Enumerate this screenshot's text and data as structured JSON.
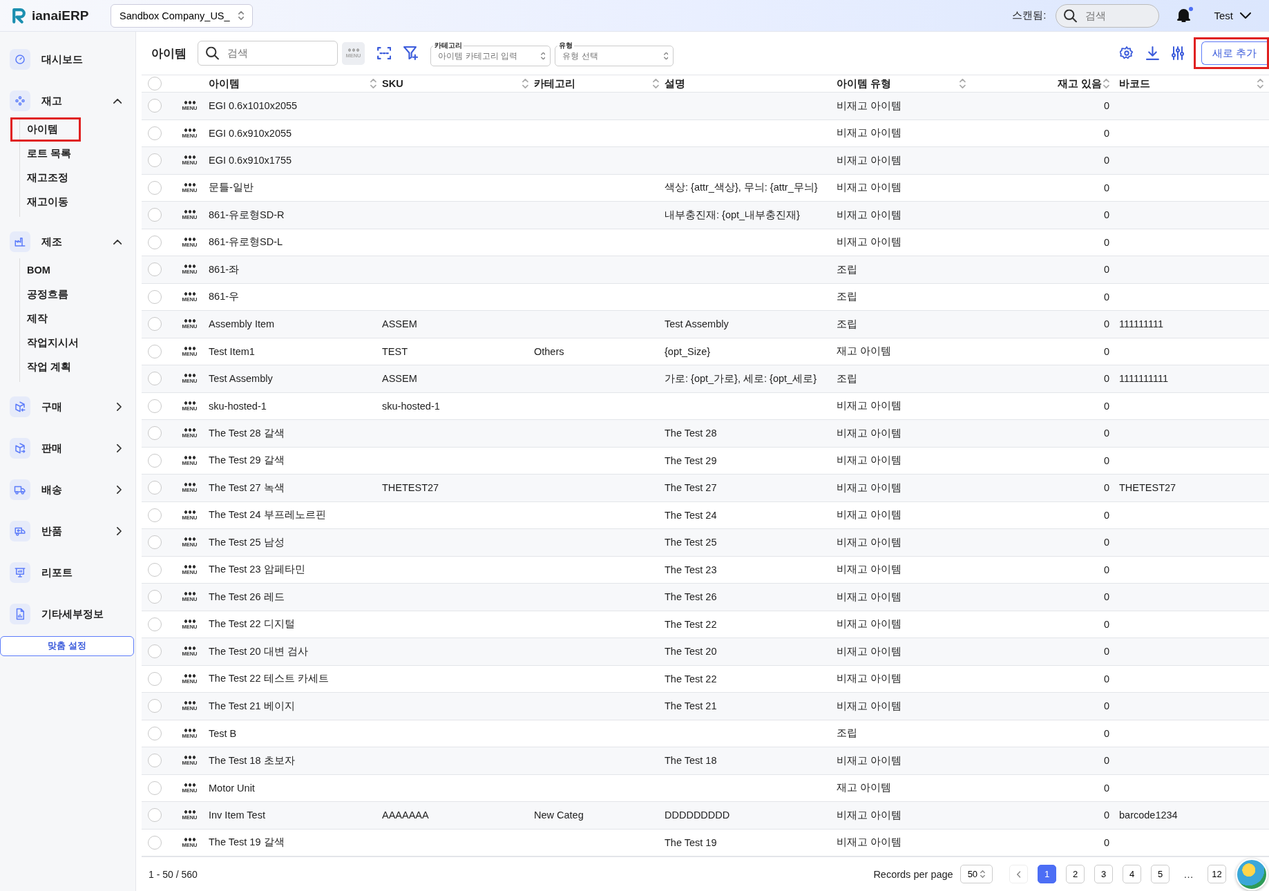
{
  "top_bar": {
    "logo": "ianaiERP",
    "company": "Sandbox Company_US_",
    "scan_label": "스캔됨:",
    "search": {
      "placeholder": "검색"
    },
    "notification_dot": true,
    "user": "Test"
  },
  "sidebar": {
    "items": [
      {
        "label": "대시보드"
      },
      {
        "label": "재고",
        "expanded": true,
        "children": [
          {
            "label": "아이템",
            "highlighted": true
          },
          {
            "label": "로트 목록",
            "highlighted": false
          },
          {
            "label": "재고조정",
            "highlighted": false
          },
          {
            "label": "재고이동",
            "highlighted": false
          }
        ]
      },
      {
        "label": "제조",
        "expanded": true,
        "children": [
          {
            "label": "BOM",
            "highlighted": false
          },
          {
            "label": "공정흐름",
            "highlighted": false
          },
          {
            "label": "제작",
            "highlighted": false
          },
          {
            "label": "작업지시서",
            "highlighted": false
          },
          {
            "label": "작업 계획",
            "highlighted": false
          }
        ]
      },
      {
        "label": "구매",
        "expanded": false
      },
      {
        "label": "판매",
        "expanded": false
      },
      {
        "label": "배송",
        "expanded": false
      },
      {
        "label": "반품",
        "expanded": false
      },
      {
        "label": "리포트"
      },
      {
        "label": "기타세부정보"
      }
    ],
    "settings_button": "맞춤 설정"
  },
  "toolbar": {
    "title": "아이템",
    "search": {
      "placeholder": "검색"
    },
    "menu_button": {
      "label": "MENU",
      "disabled": true
    },
    "category_field": {
      "label": "카테고리",
      "placeholder": "아이템 카테고리 입력"
    },
    "type_field": {
      "label": "유형",
      "placeholder": "유형 선택"
    },
    "add_button": {
      "label": "새로 추가",
      "highlighted": true
    }
  },
  "table": {
    "all_checked": false,
    "columns": [
      {
        "label": "아이템",
        "sortable": true,
        "kind": "text"
      },
      {
        "label": "SKU",
        "sortable": true,
        "kind": "text"
      },
      {
        "label": "카테고리",
        "sortable": true,
        "kind": "text"
      },
      {
        "label": "설명",
        "sortable": false,
        "kind": "text"
      },
      {
        "label": "아이템 유형",
        "sortable": true,
        "kind": "text"
      },
      {
        "label": "재고 있음",
        "sortable": true,
        "kind": "number"
      },
      {
        "label": "바코드",
        "sortable": true,
        "kind": "text"
      }
    ],
    "rows": [
      {
        "checked": false,
        "menu": "MENU",
        "cells": [
          "EGI 0.6x1010x2055",
          null,
          null,
          null,
          "비재고 아이템",
          "0",
          null
        ]
      },
      {
        "checked": false,
        "menu": "MENU",
        "cells": [
          "EGI 0.6x910x2055",
          null,
          null,
          null,
          "비재고 아이템",
          "0",
          null
        ]
      },
      {
        "checked": false,
        "menu": "MENU",
        "cells": [
          "EGI 0.6x910x1755",
          null,
          null,
          null,
          "비재고 아이템",
          "0",
          null
        ]
      },
      {
        "checked": false,
        "menu": "MENU",
        "cells": [
          "문틀-일반",
          null,
          null,
          "색상: {attr_색상}, 무늬: {attr_무늬}",
          "비재고 아이템",
          "0",
          null
        ]
      },
      {
        "checked": false,
        "menu": "MENU",
        "cells": [
          "861-유로형SD-R",
          null,
          null,
          "내부충진재: {opt_내부충진재}",
          "비재고 아이템",
          "0",
          null
        ]
      },
      {
        "checked": false,
        "menu": "MENU",
        "cells": [
          "861-유로형SD-L",
          null,
          null,
          null,
          "비재고 아이템",
          "0",
          null
        ]
      },
      {
        "checked": false,
        "menu": "MENU",
        "cells": [
          "861-좌",
          null,
          null,
          null,
          "조립",
          "0",
          null
        ]
      },
      {
        "checked": false,
        "menu": "MENU",
        "cells": [
          "861-우",
          null,
          null,
          null,
          "조립",
          "0",
          null
        ]
      },
      {
        "checked": false,
        "menu": "MENU",
        "cells": [
          "Assembly Item",
          "ASSEM",
          null,
          "Test Assembly",
          "조립",
          "0",
          "111111111"
        ]
      },
      {
        "checked": false,
        "menu": "MENU",
        "cells": [
          "Test Item1",
          "TEST",
          "Others",
          "{opt_Size}",
          "재고 아이템",
          "0",
          null
        ]
      },
      {
        "checked": false,
        "menu": "MENU",
        "cells": [
          "Test Assembly",
          "ASSEM",
          null,
          "가로: {opt_가로}, 세로: {opt_세로}",
          "조립",
          "0",
          "1111111111"
        ]
      },
      {
        "checked": false,
        "menu": "MENU",
        "cells": [
          "sku-hosted-1",
          "sku-hosted-1",
          null,
          null,
          "비재고 아이템",
          "0",
          null
        ]
      },
      {
        "checked": false,
        "menu": "MENU",
        "cells": [
          "The Test 28 갈색",
          null,
          null,
          "The Test 28",
          "비재고 아이템",
          "0",
          null
        ]
      },
      {
        "checked": false,
        "menu": "MENU",
        "cells": [
          "The Test 29 갈색",
          null,
          null,
          "The Test 29",
          "비재고 아이템",
          "0",
          null
        ]
      },
      {
        "checked": false,
        "menu": "MENU",
        "cells": [
          "The Test 27 녹색",
          "THETEST27",
          null,
          "The Test 27",
          "비재고 아이템",
          "0",
          "THETEST27"
        ]
      },
      {
        "checked": false,
        "menu": "MENU",
        "cells": [
          "The Test 24 부프레노르핀",
          null,
          null,
          "The Test 24",
          "비재고 아이템",
          "0",
          null
        ]
      },
      {
        "checked": false,
        "menu": "MENU",
        "cells": [
          "The Test 25 남성",
          null,
          null,
          "The Test 25",
          "비재고 아이템",
          "0",
          null
        ]
      },
      {
        "checked": false,
        "menu": "MENU",
        "cells": [
          "The Test 23 암페타민",
          null,
          null,
          "The Test 23",
          "비재고 아이템",
          "0",
          null
        ]
      },
      {
        "checked": false,
        "menu": "MENU",
        "cells": [
          "The Test 26 레드",
          null,
          null,
          "The Test 26",
          "비재고 아이템",
          "0",
          null
        ]
      },
      {
        "checked": false,
        "menu": "MENU",
        "cells": [
          "The Test 22 디지털",
          null,
          null,
          "The Test 22",
          "비재고 아이템",
          "0",
          null
        ]
      },
      {
        "checked": false,
        "menu": "MENU",
        "cells": [
          "The Test 20 대변 검사",
          null,
          null,
          "The Test 20",
          "비재고 아이템",
          "0",
          null
        ]
      },
      {
        "checked": false,
        "menu": "MENU",
        "cells": [
          "The Test 22 테스트 카세트",
          null,
          null,
          "The Test 22",
          "비재고 아이템",
          "0",
          null
        ]
      },
      {
        "checked": false,
        "menu": "MENU",
        "cells": [
          "The Test 21 베이지",
          null,
          null,
          "The Test 21",
          "비재고 아이템",
          "0",
          null
        ]
      },
      {
        "checked": false,
        "menu": "MENU",
        "cells": [
          "Test B",
          null,
          null,
          null,
          "조립",
          "0",
          null
        ]
      },
      {
        "checked": false,
        "menu": "MENU",
        "cells": [
          "The Test 18 초보자",
          null,
          null,
          "The Test 18",
          "비재고 아이템",
          "0",
          null
        ]
      },
      {
        "checked": false,
        "menu": "MENU",
        "cells": [
          "Motor Unit",
          null,
          null,
          null,
          "재고 아이템",
          "0",
          null
        ]
      },
      {
        "checked": false,
        "menu": "MENU",
        "cells": [
          "Inv Item Test",
          "AAAAAAA",
          "New Categ",
          "DDDDDDDDD",
          "비재고 아이템",
          "0",
          "barcode1234"
        ]
      },
      {
        "checked": false,
        "menu": "MENU",
        "cells": [
          "The Test 19 갈색",
          null,
          null,
          "The Test 19",
          "비재고 아이템",
          "0",
          null
        ]
      }
    ]
  },
  "footer": {
    "range": "1 - 50 / 560",
    "records_label": "Records per page",
    "per_page": "50",
    "pages": [
      {
        "label": "1",
        "kind": "page",
        "selected": true
      },
      {
        "label": "2",
        "kind": "page",
        "selected": false
      },
      {
        "label": "3",
        "kind": "page",
        "selected": false
      },
      {
        "label": "4",
        "kind": "page",
        "selected": false
      },
      {
        "label": "5",
        "kind": "page",
        "selected": false
      },
      {
        "label": "…",
        "kind": "ellipsis"
      },
      {
        "label": "12",
        "kind": "page",
        "selected": false
      }
    ]
  }
}
